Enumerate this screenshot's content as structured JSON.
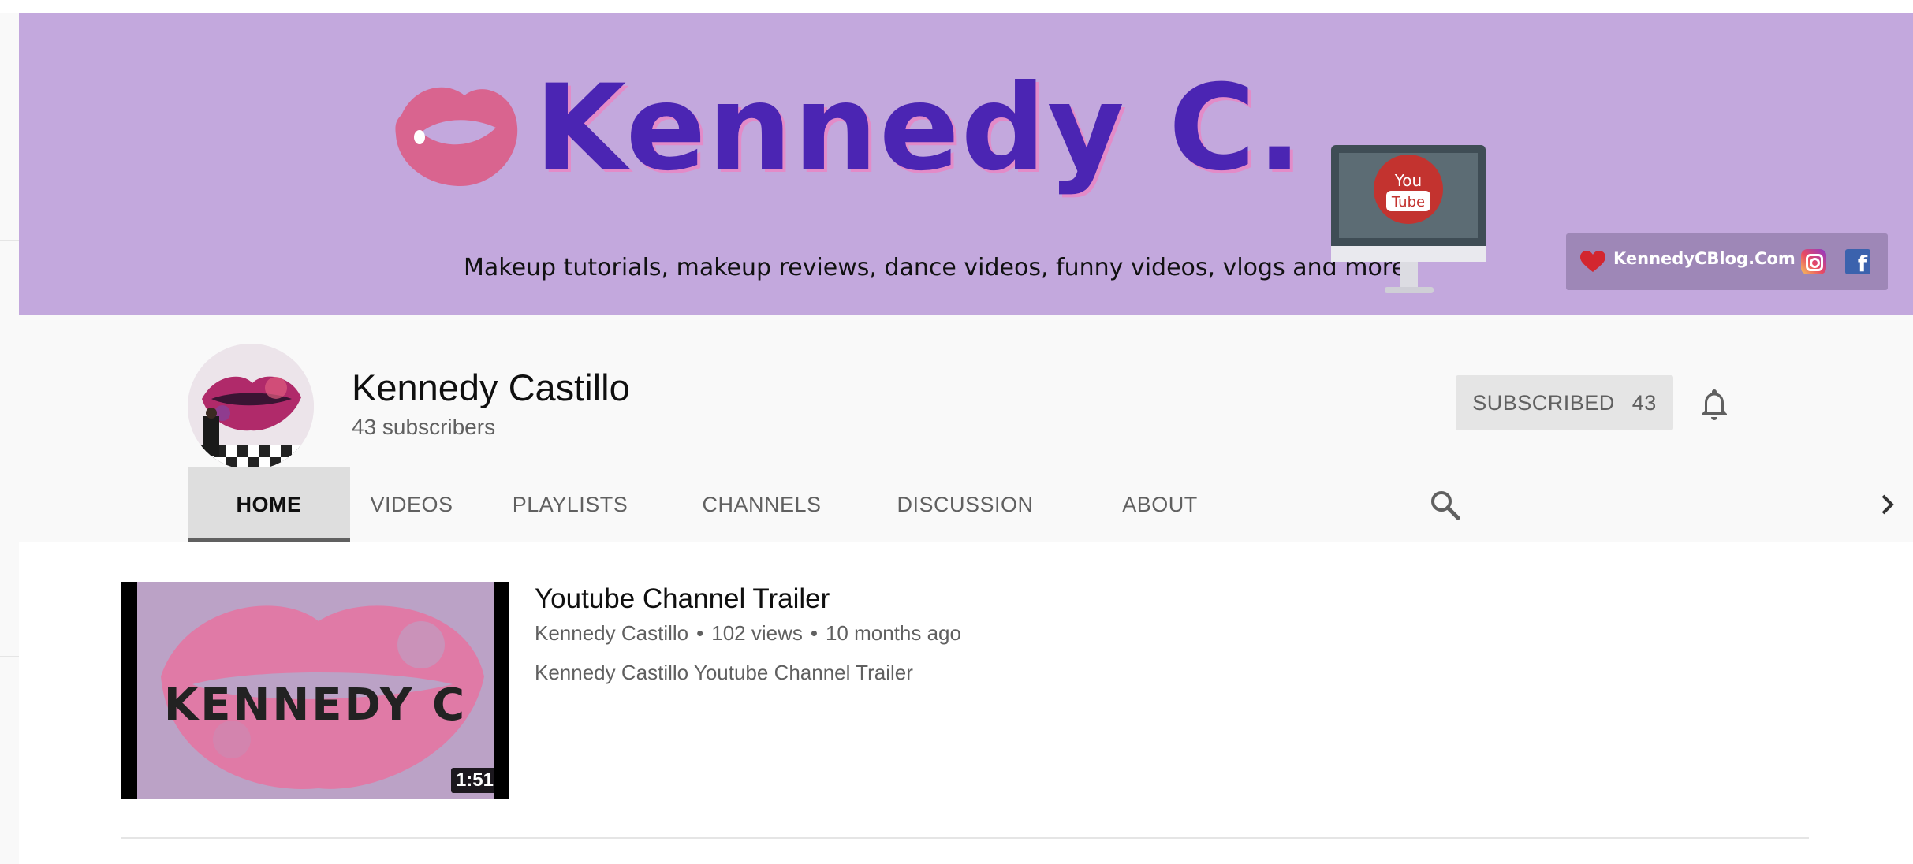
{
  "banner": {
    "title": "Kennedy C.",
    "tagline": "Makeup tutorials, makeup reviews, dance videos, funny videos, vlogs and more",
    "monitor_text_top": "You",
    "monitor_text_bottom": "Tube",
    "link_text": "KennedyCBlog.Com",
    "colors": {
      "background": "#c3a8dd",
      "title": "#4b25b3",
      "title_shadow": "#e38bc8",
      "lips": "#d9648f"
    },
    "icons": [
      "lips-logo-icon",
      "youtube-monitor-icon",
      "heart-icon",
      "instagram-icon",
      "facebook-icon"
    ]
  },
  "channel": {
    "name": "Kennedy Castillo",
    "subscribers": "43 subscribers",
    "subscribe_label": "SUBSCRIBED",
    "subscribe_count": "43",
    "avatar_icon": "avatar-lips-icon",
    "bell_icon": "bell-icon"
  },
  "tabs": [
    {
      "label": "HOME",
      "active": true
    },
    {
      "label": "VIDEOS",
      "active": false
    },
    {
      "label": "PLAYLISTS",
      "active": false
    },
    {
      "label": "CHANNELS",
      "active": false
    },
    {
      "label": "DISCUSSION",
      "active": false
    },
    {
      "label": "ABOUT",
      "active": false
    }
  ],
  "tab_icons": {
    "search": "search-icon",
    "next": "chevron-right-icon"
  },
  "featured_video": {
    "title": "Youtube Channel Trailer",
    "channel": "Kennedy Castillo",
    "views": "102 views",
    "age": "10 months ago",
    "description": "Kennedy Castillo Youtube Channel Trailer",
    "duration": "1:51",
    "thumbnail_text": "KENNEDY C"
  }
}
